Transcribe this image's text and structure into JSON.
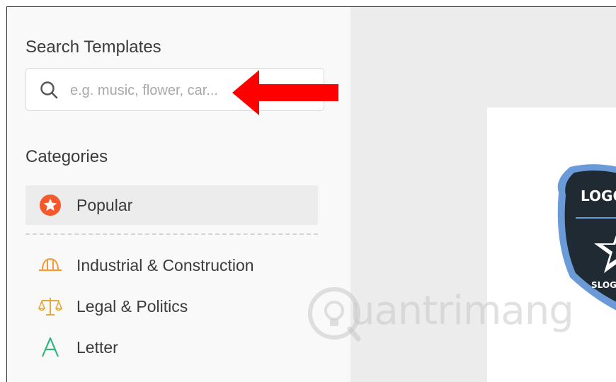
{
  "search": {
    "title": "Search Templates",
    "placeholder": "e.g. music, flower, car..."
  },
  "categories": {
    "title": "Categories",
    "items": [
      {
        "label": "Popular",
        "icon": "star-badge-icon",
        "active": true
      },
      {
        "label": "Industrial & Construction",
        "icon": "hard-hat-icon"
      },
      {
        "label": "Legal & Politics",
        "icon": "scales-icon"
      },
      {
        "label": "Letter",
        "icon": "letter-a-icon"
      },
      {
        "label": "",
        "icon": "heart-icon"
      }
    ]
  },
  "preview": {
    "badge_top_text": "LOGO",
    "badge_bottom_text": "SLOG"
  },
  "watermark": {
    "text": "uantrimang"
  },
  "colors": {
    "accent_red": "#ff0000",
    "popular_orange": "#f5582b",
    "hat_orange": "#f39a39",
    "scales_gold": "#e5a93a",
    "letter_green": "#2fb67a",
    "heart_red": "#ef4b4b",
    "badge_dark": "#1f2a33",
    "badge_border": "#6a9bd8"
  }
}
